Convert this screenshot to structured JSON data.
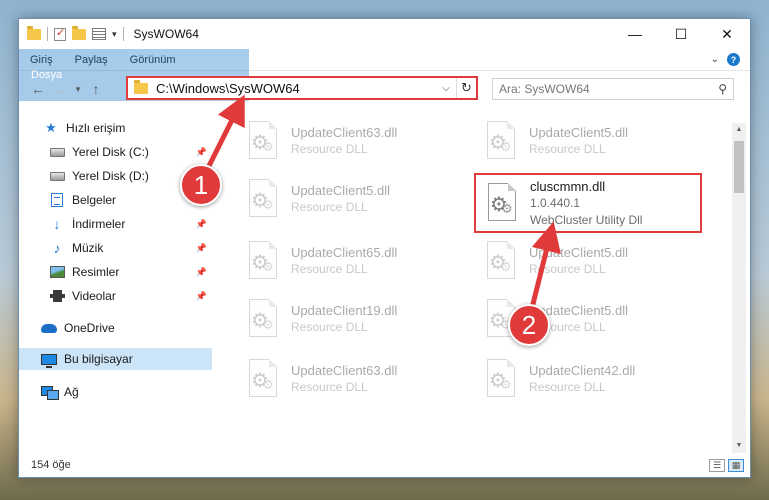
{
  "window": {
    "title": "SysWOW64",
    "controls": {
      "minimize": "—",
      "maximize": "☐",
      "close": "✕"
    }
  },
  "ribbon": {
    "tabs": [
      {
        "label": "Dosya"
      },
      {
        "label": "Giriş"
      },
      {
        "label": "Paylaş"
      },
      {
        "label": "Görünüm"
      }
    ]
  },
  "nav": {
    "address": "C:\\Windows\\SysWOW64",
    "search_placeholder": "Ara: SysWOW64"
  },
  "sidebar": {
    "items": [
      {
        "label": "Hızlı erişim",
        "icon": "star-icon"
      },
      {
        "label": "Yerel Disk (C:)",
        "icon": "disk-icon",
        "pinned": true
      },
      {
        "label": "Yerel Disk (D:)",
        "icon": "disk-icon",
        "pinned": true
      },
      {
        "label": "Belgeler",
        "icon": "documents-icon",
        "pinned": true
      },
      {
        "label": "İndirmeler",
        "icon": "download-icon",
        "pinned": true
      },
      {
        "label": "Müzik",
        "icon": "music-icon",
        "pinned": true
      },
      {
        "label": "Resimler",
        "icon": "pictures-icon",
        "pinned": true
      },
      {
        "label": "Videolar",
        "icon": "videos-icon",
        "pinned": true
      },
      {
        "label": "OneDrive",
        "icon": "onedrive-icon"
      },
      {
        "label": "Bu bilgisayar",
        "icon": "computer-icon",
        "selected": true
      },
      {
        "label": "Ağ",
        "icon": "network-icon"
      }
    ]
  },
  "files": [
    {
      "name": "UpdateClient63.dll",
      "type": "Resource DLL"
    },
    {
      "name": "UpdateClient5.dll",
      "type": "Resource DLL"
    },
    {
      "name": "UpdateClient5.dll",
      "type": "Resource DLL"
    },
    {
      "name": "cluscmmn.dll",
      "version": "1.0.440.1",
      "type": "WebCluster Utility Dll",
      "highlighted": true
    },
    {
      "name": "UpdateClient65.dll",
      "type": "Resource DLL"
    },
    {
      "name": "UpdateClient5.dll",
      "type": "Resource DLL"
    },
    {
      "name": "UpdateClient19.dll",
      "type": "Resource DLL"
    },
    {
      "name": "UpdateClient5.dll",
      "type": "Resource DLL"
    },
    {
      "name": "UpdateClient63.dll",
      "type": "Resource DLL"
    },
    {
      "name": "UpdateClient42.dll",
      "type": "Resource DLL"
    }
  ],
  "status": {
    "count": "154 öğe"
  },
  "annotations": [
    {
      "label": "1"
    },
    {
      "label": "2"
    }
  ],
  "colors": {
    "accent": "#1979ca",
    "highlight": "#e03a3a",
    "selected": "#cce4f7"
  }
}
